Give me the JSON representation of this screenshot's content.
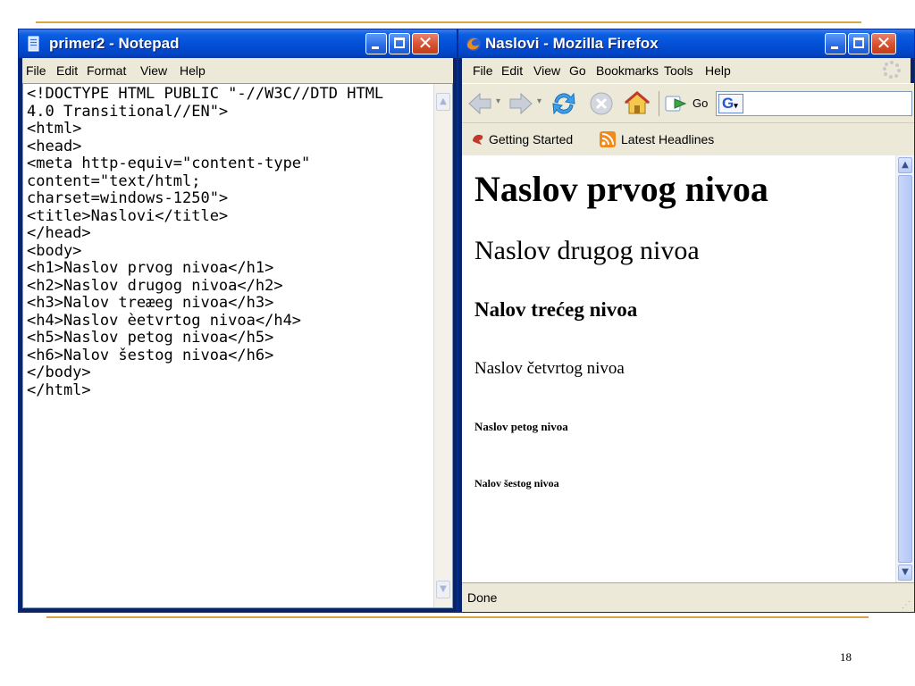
{
  "notepad": {
    "title": "primer2 - Notepad",
    "menu": [
      "File",
      "Edit",
      "Format",
      "View",
      "Help"
    ],
    "code": "<!DOCTYPE HTML PUBLIC \"-//W3C//DTD HTML\n4.0 Transitional//EN\">\n<html>\n<head>\n<meta http-equiv=\"content-type\"\ncontent=\"text/html;\ncharset=windows-1250\">\n<title>Naslovi</title>\n</head>\n<body>\n<h1>Naslov prvog nivoa</h1>\n<h2>Naslov drugog nivoa</h2>\n<h3>Nalov treæeg nivoa</h3>\n<h4>Naslov èetvrtog nivoa</h4>\n<h5>Naslov petog nivoa</h5>\n<h6>Nalov šestog nivoa</h6>\n</body>\n</html>"
  },
  "firefox": {
    "title": "Naslovi - Mozilla Firefox",
    "menu": [
      "File",
      "Edit",
      "View",
      "Go",
      "Bookmarks",
      "Tools",
      "Help"
    ],
    "go_label": "Go",
    "bookmarks": [
      "Getting Started",
      "Latest Headlines"
    ],
    "headings": {
      "h1": "Naslov prvog nivoa",
      "h2": "Naslov drugog nivoa",
      "h3": "Nalov trećeg nivoa",
      "h4": "Naslov četvrtog nivoa",
      "h5": "Naslov petog nivoa",
      "h6": "Nalov šestog nivoa"
    },
    "status": "Done"
  },
  "slide": {
    "page_number": "18",
    "accent_color": "#d9a441"
  }
}
